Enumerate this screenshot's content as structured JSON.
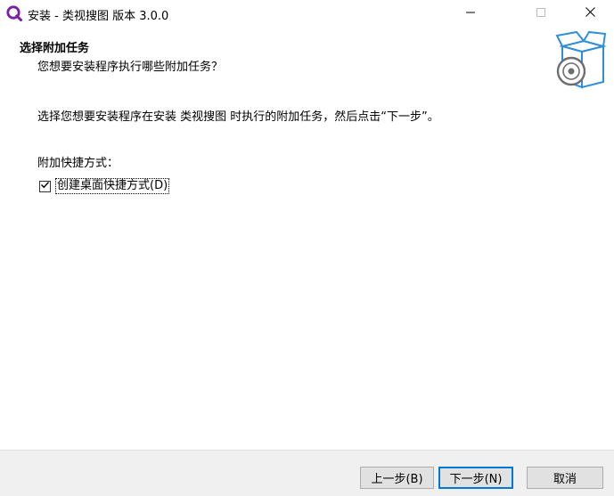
{
  "window": {
    "title": "安装 - 类视搜图 版本 3.0.0",
    "app_icon": "app-logo-icon",
    "controls": {
      "minimize_icon": "minimize-icon",
      "maximize_icon": "maximize-icon",
      "close_icon": "close-icon"
    }
  },
  "header": {
    "title": "选择附加任务",
    "subtitle": "您想要安装程序执行哪些附加任务？",
    "image_icon": "installer-box-disc-icon"
  },
  "body": {
    "instruction": "选择您想要安装程序在安装 类视搜图 时执行的附加任务，然后点击“下一步”。",
    "group_label": "附加快捷方式：",
    "tasks": [
      {
        "label": "创建桌面快捷方式(D)",
        "checked": true
      }
    ]
  },
  "footer": {
    "back_label": "上一步(B)",
    "next_label": "下一步(N)",
    "cancel_label": "取消"
  },
  "colors": {
    "accent": "#0078d7",
    "footer_bg": "#f0f0f0",
    "logo": "#7b1fa2"
  }
}
